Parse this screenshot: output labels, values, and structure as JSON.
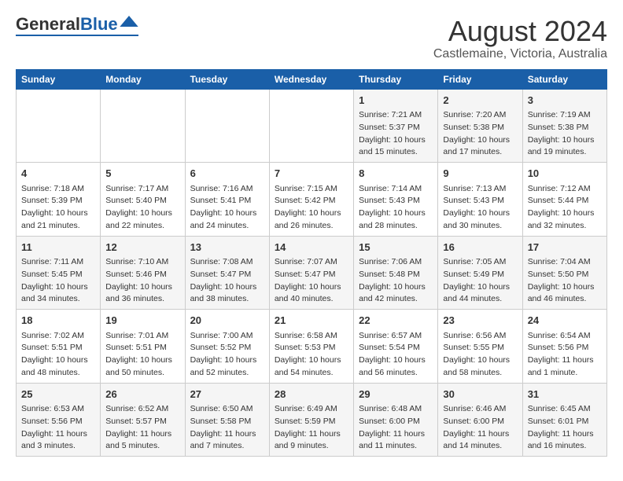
{
  "header": {
    "logo_general": "General",
    "logo_blue": "Blue",
    "title": "August 2024",
    "subtitle": "Castlemaine, Victoria, Australia"
  },
  "days_of_week": [
    "Sunday",
    "Monday",
    "Tuesday",
    "Wednesday",
    "Thursday",
    "Friday",
    "Saturday"
  ],
  "weeks": [
    [
      {
        "day": "",
        "info": ""
      },
      {
        "day": "",
        "info": ""
      },
      {
        "day": "",
        "info": ""
      },
      {
        "day": "",
        "info": ""
      },
      {
        "day": "1",
        "info": "Sunrise: 7:21 AM\nSunset: 5:37 PM\nDaylight: 10 hours\nand 15 minutes."
      },
      {
        "day": "2",
        "info": "Sunrise: 7:20 AM\nSunset: 5:38 PM\nDaylight: 10 hours\nand 17 minutes."
      },
      {
        "day": "3",
        "info": "Sunrise: 7:19 AM\nSunset: 5:38 PM\nDaylight: 10 hours\nand 19 minutes."
      }
    ],
    [
      {
        "day": "4",
        "info": "Sunrise: 7:18 AM\nSunset: 5:39 PM\nDaylight: 10 hours\nand 21 minutes."
      },
      {
        "day": "5",
        "info": "Sunrise: 7:17 AM\nSunset: 5:40 PM\nDaylight: 10 hours\nand 22 minutes."
      },
      {
        "day": "6",
        "info": "Sunrise: 7:16 AM\nSunset: 5:41 PM\nDaylight: 10 hours\nand 24 minutes."
      },
      {
        "day": "7",
        "info": "Sunrise: 7:15 AM\nSunset: 5:42 PM\nDaylight: 10 hours\nand 26 minutes."
      },
      {
        "day": "8",
        "info": "Sunrise: 7:14 AM\nSunset: 5:43 PM\nDaylight: 10 hours\nand 28 minutes."
      },
      {
        "day": "9",
        "info": "Sunrise: 7:13 AM\nSunset: 5:43 PM\nDaylight: 10 hours\nand 30 minutes."
      },
      {
        "day": "10",
        "info": "Sunrise: 7:12 AM\nSunset: 5:44 PM\nDaylight: 10 hours\nand 32 minutes."
      }
    ],
    [
      {
        "day": "11",
        "info": "Sunrise: 7:11 AM\nSunset: 5:45 PM\nDaylight: 10 hours\nand 34 minutes."
      },
      {
        "day": "12",
        "info": "Sunrise: 7:10 AM\nSunset: 5:46 PM\nDaylight: 10 hours\nand 36 minutes."
      },
      {
        "day": "13",
        "info": "Sunrise: 7:08 AM\nSunset: 5:47 PM\nDaylight: 10 hours\nand 38 minutes."
      },
      {
        "day": "14",
        "info": "Sunrise: 7:07 AM\nSunset: 5:47 PM\nDaylight: 10 hours\nand 40 minutes."
      },
      {
        "day": "15",
        "info": "Sunrise: 7:06 AM\nSunset: 5:48 PM\nDaylight: 10 hours\nand 42 minutes."
      },
      {
        "day": "16",
        "info": "Sunrise: 7:05 AM\nSunset: 5:49 PM\nDaylight: 10 hours\nand 44 minutes."
      },
      {
        "day": "17",
        "info": "Sunrise: 7:04 AM\nSunset: 5:50 PM\nDaylight: 10 hours\nand 46 minutes."
      }
    ],
    [
      {
        "day": "18",
        "info": "Sunrise: 7:02 AM\nSunset: 5:51 PM\nDaylight: 10 hours\nand 48 minutes."
      },
      {
        "day": "19",
        "info": "Sunrise: 7:01 AM\nSunset: 5:51 PM\nDaylight: 10 hours\nand 50 minutes."
      },
      {
        "day": "20",
        "info": "Sunrise: 7:00 AM\nSunset: 5:52 PM\nDaylight: 10 hours\nand 52 minutes."
      },
      {
        "day": "21",
        "info": "Sunrise: 6:58 AM\nSunset: 5:53 PM\nDaylight: 10 hours\nand 54 minutes."
      },
      {
        "day": "22",
        "info": "Sunrise: 6:57 AM\nSunset: 5:54 PM\nDaylight: 10 hours\nand 56 minutes."
      },
      {
        "day": "23",
        "info": "Sunrise: 6:56 AM\nSunset: 5:55 PM\nDaylight: 10 hours\nand 58 minutes."
      },
      {
        "day": "24",
        "info": "Sunrise: 6:54 AM\nSunset: 5:56 PM\nDaylight: 11 hours\nand 1 minute."
      }
    ],
    [
      {
        "day": "25",
        "info": "Sunrise: 6:53 AM\nSunset: 5:56 PM\nDaylight: 11 hours\nand 3 minutes."
      },
      {
        "day": "26",
        "info": "Sunrise: 6:52 AM\nSunset: 5:57 PM\nDaylight: 11 hours\nand 5 minutes."
      },
      {
        "day": "27",
        "info": "Sunrise: 6:50 AM\nSunset: 5:58 PM\nDaylight: 11 hours\nand 7 minutes."
      },
      {
        "day": "28",
        "info": "Sunrise: 6:49 AM\nSunset: 5:59 PM\nDaylight: 11 hours\nand 9 minutes."
      },
      {
        "day": "29",
        "info": "Sunrise: 6:48 AM\nSunset: 6:00 PM\nDaylight: 11 hours\nand 11 minutes."
      },
      {
        "day": "30",
        "info": "Sunrise: 6:46 AM\nSunset: 6:00 PM\nDaylight: 11 hours\nand 14 minutes."
      },
      {
        "day": "31",
        "info": "Sunrise: 6:45 AM\nSunset: 6:01 PM\nDaylight: 11 hours\nand 16 minutes."
      }
    ]
  ]
}
